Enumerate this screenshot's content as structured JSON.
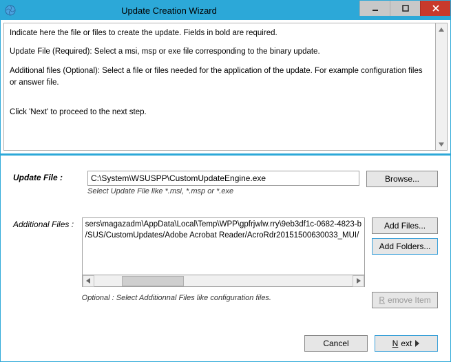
{
  "window": {
    "title": "Update Creation Wizard"
  },
  "info": {
    "p1": "Indicate here the file or files to create the update. Fields in bold are required.",
    "p2": "Update File (Required): Select a msi, msp or exe file corresponding to the binary update.",
    "p3": "Additional files (Optional): Select a file or files needed for the application of the update. For example configuration files or answer file.",
    "p4": "Click 'Next' to proceed to the next step."
  },
  "updateFile": {
    "label": "Update File :",
    "value": "C:\\System\\WSUSPP\\CustomUpdateEngine.exe",
    "hint": "Select Update File like *.msi, *.msp or *.exe",
    "browse": "Browse..."
  },
  "additional": {
    "label": "Additional Files :",
    "line1": "sers\\magazadm\\AppData\\Local\\Temp\\WPP\\gpfrjwlw.rry\\9eb3df1c-0682-4823-b",
    "line2": "/SUS/CustomUpdates/Adobe Acrobat Reader/AcroRdr20151500630033_MUI/",
    "addFiles": "Add Files...",
    "addFolders": "Add Folders...",
    "removeItem": "Remove Item",
    "hint": "Optional : Select Additionnal Files like configuration files."
  },
  "footer": {
    "cancel": "Cancel",
    "next": "Next"
  }
}
